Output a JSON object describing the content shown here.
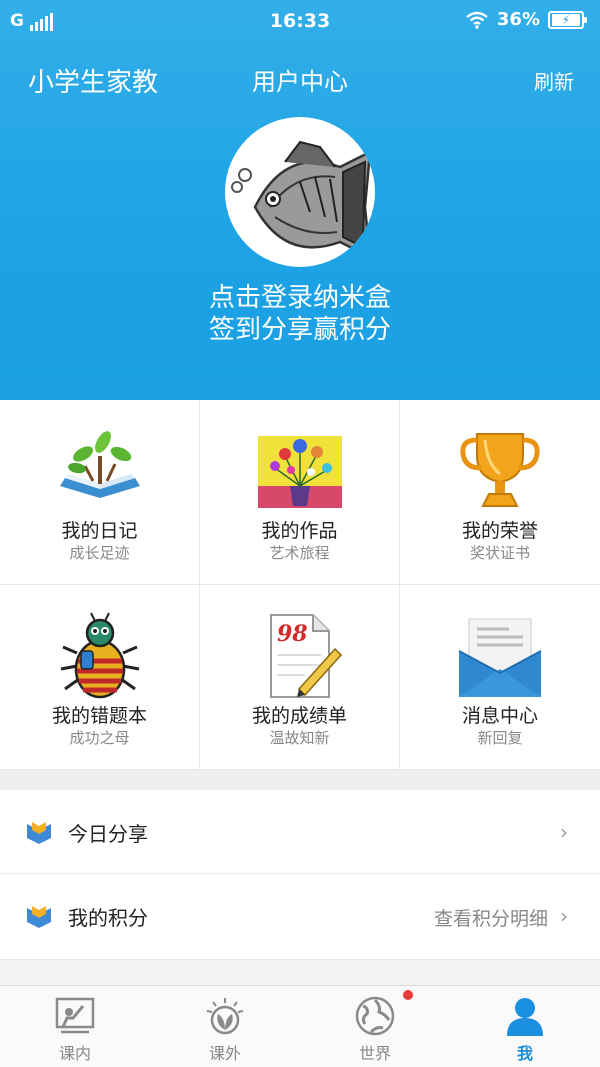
{
  "status_bar": {
    "carrier": "G",
    "time": "16:33",
    "battery": "36%"
  },
  "header": {
    "app_name": "小学生家教",
    "title": "用户中心",
    "refresh_label": "刷新",
    "login_line1": "点击登录纳米盒",
    "login_line2": "签到分享赢积分"
  },
  "grid": [
    {
      "title": "我的日记",
      "subtitle": "成长足迹",
      "icon": "book-sprout-icon"
    },
    {
      "title": "我的作品",
      "subtitle": "艺术旅程",
      "icon": "flower-painting-icon"
    },
    {
      "title": "我的荣誉",
      "subtitle": "奖状证书",
      "icon": "trophy-icon"
    },
    {
      "title": "我的错题本",
      "subtitle": "成功之母",
      "icon": "beetle-icon"
    },
    {
      "title": "我的成绩单",
      "subtitle": "温故知新",
      "icon": "score-sheet-icon"
    },
    {
      "title": "消息中心",
      "subtitle": "新回复",
      "icon": "envelope-icon"
    }
  ],
  "list": [
    {
      "label": "今日分享",
      "value": ""
    },
    {
      "label": "我的积分",
      "value": "查看积分明细"
    }
  ],
  "tabs": [
    {
      "label": "课内",
      "icon": "classroom-icon",
      "active": false
    },
    {
      "label": "课外",
      "icon": "sun-leaf-icon",
      "active": false
    },
    {
      "label": "世界",
      "icon": "globe-icon",
      "active": false
    },
    {
      "label": "我",
      "icon": "user-icon",
      "active": true
    }
  ],
  "score_badge": "98",
  "colors": {
    "primary": "#1da3e5",
    "active_tab": "#1a8fe0",
    "badge": "#e53935"
  }
}
